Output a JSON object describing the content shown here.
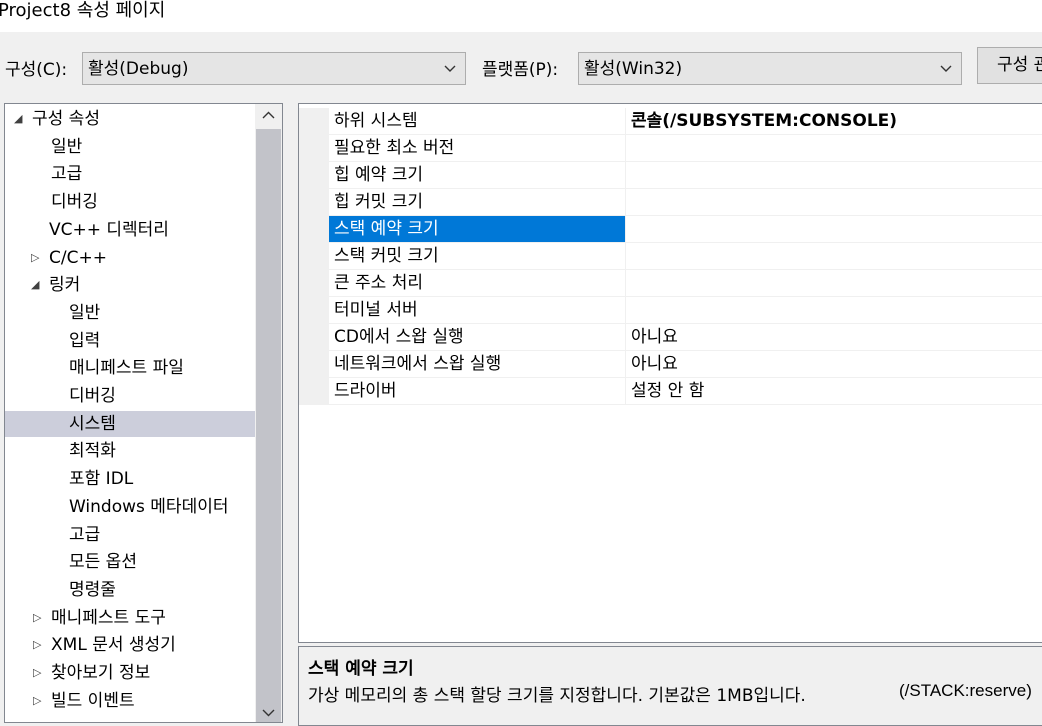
{
  "window": {
    "title": "Project8 속성 페이지"
  },
  "toolbar": {
    "config_label": "구성(C):",
    "config_value": "활성(Debug)",
    "platform_label": "플랫폼(P):",
    "platform_value": "활성(Win32)",
    "config_manager_label": "구성 관리자"
  },
  "tree": {
    "items": [
      {
        "label": "구성 속성",
        "expander": "◢"
      },
      {
        "label": "일반"
      },
      {
        "label": "고급"
      },
      {
        "label": "디버깅"
      },
      {
        "label": "VC++ 디렉터리"
      },
      {
        "label": "C/C++",
        "expander": "▷"
      },
      {
        "label": "링커",
        "expander": "◢"
      },
      {
        "label": "일반"
      },
      {
        "label": "입력"
      },
      {
        "label": "매니페스트 파일"
      },
      {
        "label": "디버깅"
      },
      {
        "label": "시스템",
        "selected": true
      },
      {
        "label": "최적화"
      },
      {
        "label": "포함 IDL"
      },
      {
        "label": "Windows 메타데이터"
      },
      {
        "label": "고급"
      },
      {
        "label": "모든 옵션"
      },
      {
        "label": "명령줄"
      },
      {
        "label": "매니페스트 도구",
        "expander": "▷"
      },
      {
        "label": "XML 문서 생성기",
        "expander": "▷"
      },
      {
        "label": "찾아보기 정보",
        "expander": "▷"
      },
      {
        "label": "빌드 이벤트",
        "expander": "▷"
      }
    ]
  },
  "grid": {
    "rows": [
      {
        "name": "하위 시스템",
        "value": "콘솔(/SUBSYSTEM:CONSOLE)",
        "bold": true
      },
      {
        "name": "필요한 최소 버전",
        "value": ""
      },
      {
        "name": "힙 예약 크기",
        "value": ""
      },
      {
        "name": "힙 커밋 크기",
        "value": ""
      },
      {
        "name": "스택 예약 크기",
        "value": "",
        "selected": true
      },
      {
        "name": "스택 커밋 크기",
        "value": ""
      },
      {
        "name": "큰 주소 처리",
        "value": ""
      },
      {
        "name": "터미널 서버",
        "value": ""
      },
      {
        "name": "CD에서 스왑 실행",
        "value": "아니요"
      },
      {
        "name": "네트워크에서 스왑 실행",
        "value": "아니요"
      },
      {
        "name": "드라이버",
        "value": "설정 안 함"
      }
    ]
  },
  "description": {
    "title": "스택 예약 크기",
    "text": "가상 메모리의 총 스택 할당 크기를 지정합니다. 기본값은 1MB입니다.",
    "switch": "(/STACK:reserve)"
  },
  "colors": {
    "selection": "#0078d7",
    "tree_selection": "#cccedb"
  }
}
